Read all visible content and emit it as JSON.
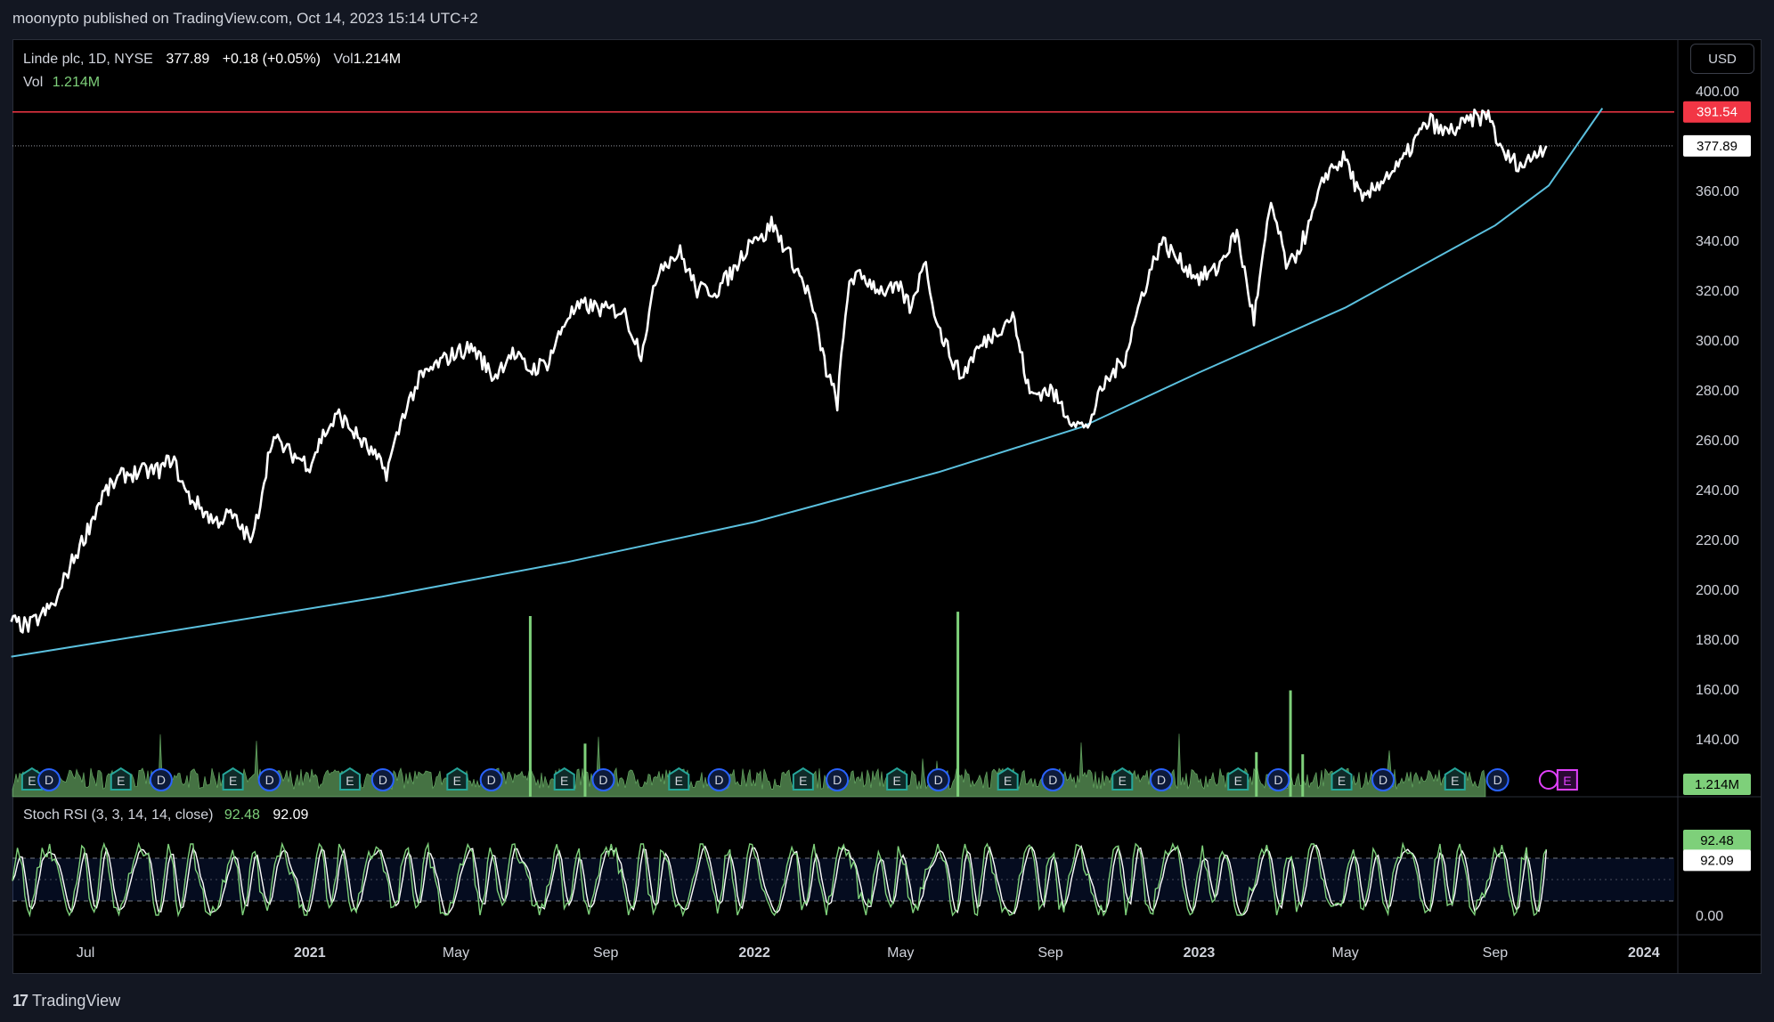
{
  "header": {
    "publish_text": "moonypto published on TradingView.com, Oct 14, 2023 15:14 UTC+2"
  },
  "legend": {
    "symbol": "Linde plc, 1D, NYSE",
    "price": "377.89",
    "change": "+0.18 (+0.05%)",
    "vol_inline_label": "Vol",
    "vol_inline_value": "1.214M",
    "vol_label": "Vol",
    "vol_value": "1.214M"
  },
  "stoch": {
    "label": "Stoch RSI (3, 3, 14, 14, close)",
    "k": "92.48",
    "d": "92.09"
  },
  "currency_button": "USD",
  "footer": {
    "brand": "TradingView",
    "logo_glyph": "17"
  },
  "colors": {
    "price_line": "#ffffff",
    "curve": "#5bc0de",
    "resistance": "#f23645",
    "volume": "#7ed07a",
    "stoch_k": "#7ed07a",
    "stoch_d": "#ffffff",
    "earnings_icon": "#26a69a",
    "dividend_icon": "#2962ff",
    "upcoming_earnings": "#e040fb"
  },
  "chart_data": {
    "type": "line",
    "title": "Linde plc, 1D, NYSE",
    "ylim": [
      125,
      405
    ],
    "price_ticks": [
      "400.00",
      "380.00",
      "360.00",
      "340.00",
      "320.00",
      "300.00",
      "280.00",
      "260.00",
      "240.00",
      "220.00",
      "200.00",
      "180.00",
      "160.00",
      "140.00"
    ],
    "price_tick_values": [
      400,
      380,
      360,
      340,
      320,
      300,
      280,
      260,
      240,
      220,
      200,
      180,
      160,
      140
    ],
    "time_axis": {
      "range": [
        "2020-05-02",
        "2024-01-26"
      ],
      "labels": [
        {
          "label": "Jul",
          "date": "2020-07-01"
        },
        {
          "label": "2021",
          "date": "2021-01-01"
        },
        {
          "label": "May",
          "date": "2021-05-01"
        },
        {
          "label": "Sep",
          "date": "2021-09-01"
        },
        {
          "label": "2022",
          "date": "2022-01-01"
        },
        {
          "label": "May",
          "date": "2022-05-01"
        },
        {
          "label": "Sep",
          "date": "2022-09-01"
        },
        {
          "label": "2023",
          "date": "2023-01-01"
        },
        {
          "label": "May",
          "date": "2023-05-01"
        },
        {
          "label": "Sep",
          "date": "2023-09-01"
        },
        {
          "label": "2024",
          "date": "2024-01-01"
        }
      ]
    },
    "series": [
      {
        "x": [
          "2020-05-01",
          "2020-05-15",
          "2020-06-01",
          "2020-06-08",
          "2020-06-15",
          "2020-07-01",
          "2020-07-15",
          "2020-08-01",
          "2020-08-15",
          "2020-09-01",
          "2020-09-10",
          "2020-09-22",
          "2020-10-01",
          "2020-10-15",
          "2020-10-28",
          "2020-11-05",
          "2020-11-15",
          "2020-12-01",
          "2020-12-15",
          "2021-01-01",
          "2021-01-12",
          "2021-01-25",
          "2021-02-08",
          "2021-02-22",
          "2021-03-05",
          "2021-03-20",
          "2021-04-01",
          "2021-04-15",
          "2021-05-01",
          "2021-05-15",
          "2021-06-01",
          "2021-06-15",
          "2021-07-01",
          "2021-07-15",
          "2021-08-01",
          "2021-08-15",
          "2021-09-01",
          "2021-09-15",
          "2021-09-30",
          "2021-10-15",
          "2021-11-01",
          "2021-11-15",
          "2021-12-01",
          "2021-12-15",
          "2022-01-01",
          "2022-01-07",
          "2022-01-15",
          "2022-02-01",
          "2022-02-15",
          "2022-03-01",
          "2022-03-10",
          "2022-03-20",
          "2022-04-01",
          "2022-04-15",
          "2022-05-01",
          "2022-05-10",
          "2022-05-20",
          "2022-06-01",
          "2022-06-10",
          "2022-06-20",
          "2022-07-01",
          "2022-07-15",
          "2022-08-01",
          "2022-08-15",
          "2022-09-01",
          "2022-09-15",
          "2022-09-30",
          "2022-10-15",
          "2022-11-01",
          "2022-11-15",
          "2022-12-01",
          "2022-12-15",
          "2023-01-01",
          "2023-01-15",
          "2023-02-01",
          "2023-02-15",
          "2023-03-01",
          "2023-03-15",
          "2023-04-01",
          "2023-04-15",
          "2023-05-01",
          "2023-05-15",
          "2023-06-01",
          "2023-06-15",
          "2023-07-01",
          "2023-07-10",
          "2023-07-20",
          "2023-08-01",
          "2023-08-15",
          "2023-08-28",
          "2023-09-05",
          "2023-09-15",
          "2023-09-25",
          "2023-10-05",
          "2023-10-13"
        ],
        "y": [
          187,
          185,
          192,
          196,
          206,
          222,
          238,
          246,
          247,
          248,
          253,
          238,
          234,
          227,
          230,
          225,
          219,
          261,
          255,
          250,
          262,
          270,
          262,
          254,
          247,
          272,
          284,
          290,
          295,
          297,
          285,
          295,
          288,
          291,
          310,
          314,
          312,
          312,
          295,
          330,
          335,
          320,
          320,
          328,
          343,
          340,
          347,
          332,
          318,
          288,
          275,
          325,
          325,
          320,
          320,
          312,
          333,
          305,
          295,
          285,
          295,
          302,
          310,
          278,
          280,
          270,
          264,
          282,
          293,
          318,
          340,
          332,
          325,
          328,
          343,
          308,
          355,
          328,
          345,
          367,
          373,
          355,
          365,
          370,
          383,
          388,
          383,
          385,
          389,
          390,
          376,
          372,
          370,
          376,
          377.89
        ]
      }
    ],
    "curve": {
      "name": "",
      "x": [
        "2020-05-01",
        "2020-10-01",
        "2021-03-01",
        "2021-08-01",
        "2022-01-01",
        "2022-06-01",
        "2022-09-26",
        "2023-01-01",
        "2023-05-01",
        "2023-09-01",
        "2023-10-15",
        "2023-11-28"
      ],
      "y": [
        173,
        185,
        197,
        211,
        227,
        247,
        265,
        287,
        313,
        346,
        362,
        393
      ]
    },
    "resistance": {
      "value": 391.54,
      "label": "391.54"
    },
    "last_price": {
      "value": 377.89,
      "label": "377.89"
    },
    "volume": {
      "current": "1.214M",
      "spikes": [
        {
          "x": "2021-07-01",
          "value": 8.5
        },
        {
          "x": "2021-08-15",
          "value": 2.5
        },
        {
          "x": "2022-06-17",
          "value": 8.7
        },
        {
          "x": "2023-02-17",
          "value": 2.1
        },
        {
          "x": "2023-03-17",
          "value": 5.0
        },
        {
          "x": "2023-03-27",
          "value": 2.0
        }
      ],
      "baseline": 0.9,
      "max_value": 9
    },
    "event_icons": [
      {
        "type": "E",
        "x": "2020-05-18"
      },
      {
        "type": "D",
        "x": "2020-06-01"
      },
      {
        "type": "E",
        "x": "2020-07-30"
      },
      {
        "type": "D",
        "x": "2020-09-01"
      },
      {
        "type": "E",
        "x": "2020-10-30"
      },
      {
        "type": "D",
        "x": "2020-11-29"
      },
      {
        "type": "E",
        "x": "2021-02-03"
      },
      {
        "type": "D",
        "x": "2021-03-02"
      },
      {
        "type": "E",
        "x": "2021-05-02"
      },
      {
        "type": "D",
        "x": "2021-05-30"
      },
      {
        "type": "E",
        "x": "2021-07-29"
      },
      {
        "type": "D",
        "x": "2021-08-30"
      },
      {
        "type": "E",
        "x": "2021-10-31"
      },
      {
        "type": "D",
        "x": "2021-12-03"
      },
      {
        "type": "E",
        "x": "2022-02-10"
      },
      {
        "type": "D",
        "x": "2022-03-10"
      },
      {
        "type": "E",
        "x": "2022-04-28"
      },
      {
        "type": "D",
        "x": "2022-06-01"
      },
      {
        "type": "E",
        "x": "2022-07-28"
      },
      {
        "type": "D",
        "x": "2022-09-03"
      },
      {
        "type": "E",
        "x": "2022-10-30"
      },
      {
        "type": "D",
        "x": "2022-12-01"
      },
      {
        "type": "E",
        "x": "2023-02-02"
      },
      {
        "type": "D",
        "x": "2023-03-07"
      },
      {
        "type": "E",
        "x": "2023-04-28"
      },
      {
        "type": "D",
        "x": "2023-06-01"
      },
      {
        "type": "E",
        "x": "2023-07-30"
      },
      {
        "type": "D",
        "x": "2023-09-03"
      },
      {
        "type": "E_upcoming",
        "x": "2023-10-28"
      }
    ],
    "stoch_rsi": {
      "ylim": [
        -10,
        110
      ],
      "bands": [
        20,
        80
      ],
      "tick": "0.00",
      "k_last": 92.48,
      "d_last": 92.09,
      "cycles": 52
    }
  }
}
